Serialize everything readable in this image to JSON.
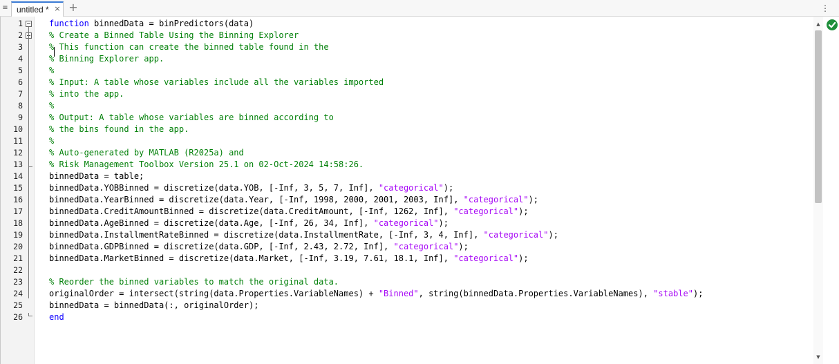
{
  "tabbar": {
    "tab_label": "untitled * ",
    "close_glyph": "×",
    "add_glyph": "+",
    "menu_glyph": "≡",
    "more_glyph": "⋮"
  },
  "editor": {
    "line_numbers": [
      "1",
      "2",
      "3",
      "4",
      "5",
      "6",
      "7",
      "8",
      "9",
      "10",
      "11",
      "12",
      "13",
      "14",
      "15",
      "16",
      "17",
      "18",
      "19",
      "20",
      "21",
      "22",
      "23",
      "24",
      "25",
      "26"
    ],
    "lines": [
      [
        {
          "t": "kw",
          "v": "function"
        },
        {
          "t": "n",
          "v": " binnedData = binPredictors(data)"
        }
      ],
      [
        {
          "t": "cm",
          "v": "% Create a Binned Table Using the Binning Explorer"
        }
      ],
      [
        {
          "t": "cm",
          "v": "% This function can create the binned table found in the"
        }
      ],
      [
        {
          "t": "cm",
          "v": "% Binning Explorer app."
        }
      ],
      [
        {
          "t": "cm",
          "v": "%"
        }
      ],
      [
        {
          "t": "cm",
          "v": "% Input: A table whose variables include all the variables imported"
        }
      ],
      [
        {
          "t": "cm",
          "v": "% into the app."
        }
      ],
      [
        {
          "t": "cm",
          "v": "%"
        }
      ],
      [
        {
          "t": "cm",
          "v": "% Output: A table whose variables are binned according to"
        }
      ],
      [
        {
          "t": "cm",
          "v": "% the bins found in the app."
        }
      ],
      [
        {
          "t": "cm",
          "v": "%"
        }
      ],
      [
        {
          "t": "cm",
          "v": "% Auto-generated by MATLAB (R2025a) and"
        }
      ],
      [
        {
          "t": "cm",
          "v": "% Risk Management Toolbox Version 25.1 on 02-Oct-2024 14:58:26."
        }
      ],
      [
        {
          "t": "n",
          "v": "binnedData = table;"
        }
      ],
      [
        {
          "t": "n",
          "v": "binnedData.YOBBinned = discretize(data.YOB, [-Inf, 3, 5, 7, Inf], "
        },
        {
          "t": "st",
          "v": "\"categorical\""
        },
        {
          "t": "n",
          "v": ");"
        }
      ],
      [
        {
          "t": "n",
          "v": "binnedData.YearBinned = discretize(data.Year, [-Inf, 1998, 2000, 2001, 2003, Inf], "
        },
        {
          "t": "st",
          "v": "\"categorical\""
        },
        {
          "t": "n",
          "v": ");"
        }
      ],
      [
        {
          "t": "n",
          "v": "binnedData.CreditAmountBinned = discretize(data.CreditAmount, [-Inf, 1262, Inf], "
        },
        {
          "t": "st",
          "v": "\"categorical\""
        },
        {
          "t": "n",
          "v": ");"
        }
      ],
      [
        {
          "t": "n",
          "v": "binnedData.AgeBinned = discretize(data.Age, [-Inf, 26, 34, Inf], "
        },
        {
          "t": "st",
          "v": "\"categorical\""
        },
        {
          "t": "n",
          "v": ");"
        }
      ],
      [
        {
          "t": "n",
          "v": "binnedData.InstallmentRateBinned = discretize(data.InstallmentRate, [-Inf, 3, 4, Inf], "
        },
        {
          "t": "st",
          "v": "\"categorical\""
        },
        {
          "t": "n",
          "v": ");"
        }
      ],
      [
        {
          "t": "n",
          "v": "binnedData.GDPBinned = discretize(data.GDP, [-Inf, 2.43, 2.72, Inf], "
        },
        {
          "t": "st",
          "v": "\"categorical\""
        },
        {
          "t": "n",
          "v": ");"
        }
      ],
      [
        {
          "t": "n",
          "v": "binnedData.MarketBinned = discretize(data.Market, [-Inf, 3.19, 7.61, 18.1, Inf], "
        },
        {
          "t": "st",
          "v": "\"categorical\""
        },
        {
          "t": "n",
          "v": ");"
        }
      ],
      [
        {
          "t": "n",
          "v": ""
        }
      ],
      [
        {
          "t": "cm",
          "v": "% Reorder the binned variables to match the original data."
        }
      ],
      [
        {
          "t": "n",
          "v": "originalOrder = intersect(string(data.Properties.VariableNames) + "
        },
        {
          "t": "st",
          "v": "\"Binned\""
        },
        {
          "t": "n",
          "v": ", string(binnedData.Properties.VariableNames), "
        },
        {
          "t": "st",
          "v": "\"stable\""
        },
        {
          "t": "n",
          "v": ");"
        }
      ],
      [
        {
          "t": "n",
          "v": "binnedData = binnedData(:, originalOrder);"
        }
      ],
      [
        {
          "t": "kw",
          "v": "end"
        }
      ]
    ]
  },
  "colors": {
    "keyword": "#0e00ff",
    "comment": "#028009",
    "string": "#a709f5",
    "status_ok": "#1e8f3a"
  },
  "icons": [
    "document-menu-icon",
    "close-tab-icon",
    "add-tab-icon",
    "more-options-icon",
    "fold-collapse-icon",
    "status-ok-icon",
    "scroll-up-icon",
    "scroll-down-icon"
  ]
}
